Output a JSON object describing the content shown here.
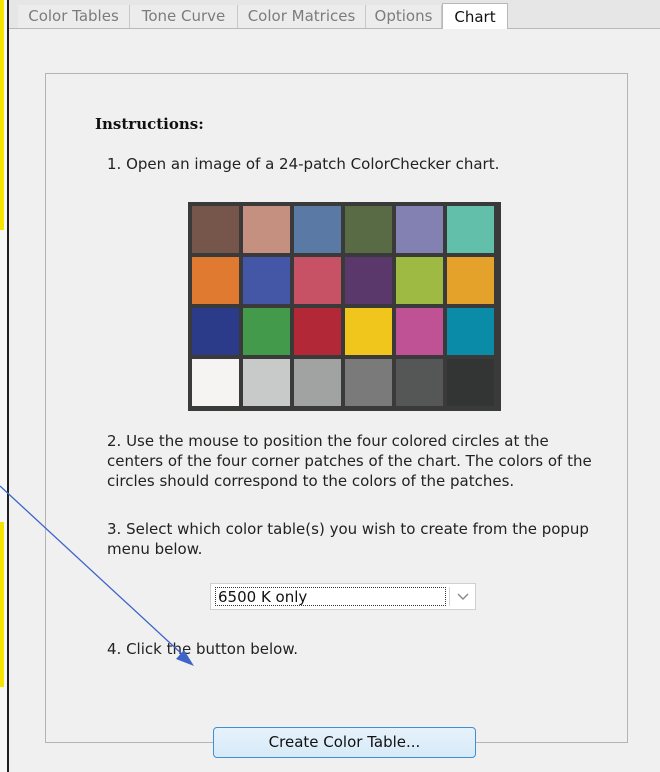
{
  "tabs": [
    {
      "label": "Color Tables",
      "active": false
    },
    {
      "label": "Tone Curve",
      "active": false
    },
    {
      "label": "Color Matrices",
      "active": false
    },
    {
      "label": "Options",
      "active": false
    },
    {
      "label": "Chart",
      "active": true
    }
  ],
  "instructions": {
    "heading": "Instructions:",
    "step1": "1. Open an image of a 24-patch ColorChecker chart.",
    "step2": "2. Use the mouse to position the four colored circles at the centers of the four corner patches of the chart. The colors of the circles should correspond to the colors of the patches.",
    "step3": "3. Select which color table(s) you wish to create from the popup menu below.",
    "step4": "4. Click the button below."
  },
  "color_table_popup": {
    "selected": "6500 K only"
  },
  "create_button": {
    "label": "Create Color Table..."
  },
  "chart_patches": [
    "#76554a",
    "#c59080",
    "#5a7aa5",
    "#596b44",
    "#8381b1",
    "#61bfaa",
    "#e07a30",
    "#4357a6",
    "#c85265",
    "#5b386b",
    "#9eba43",
    "#e4a22a",
    "#2c3a8a",
    "#439a4b",
    "#b32837",
    "#f0c51c",
    "#bf5295",
    "#0a8ca8",
    "#f5f4f2",
    "#c8c9c9",
    "#a1a2a2",
    "#7a7a7a",
    "#555656",
    "#333434"
  ],
  "colors": {
    "accent": "#3d8fd6",
    "annotation_arrow": "#3d64c8",
    "highlight": "#f6e300"
  }
}
